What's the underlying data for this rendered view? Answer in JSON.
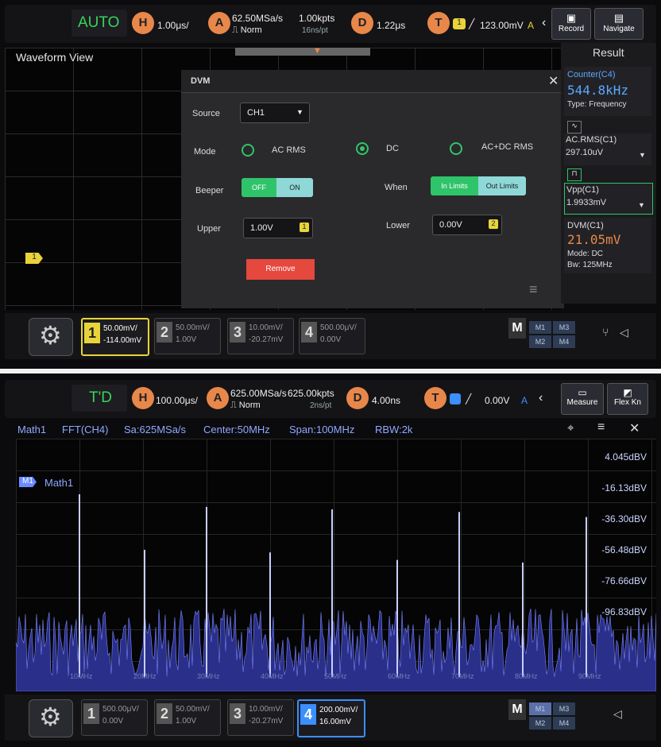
{
  "screen1": {
    "mode": "AUTO",
    "timebase": "1.00μs/",
    "sample_rate": "62.50MSa/s",
    "points": "1.00kpts",
    "acq_mode": "Norm",
    "acq_sub": "16ns/pt",
    "delay": "1.22μs",
    "trigger_level": "123.00mV",
    "trigger_mode": "A",
    "labels": {
      "h": "H",
      "a": "A",
      "d": "D",
      "t": "T"
    },
    "record_label": "Record",
    "navigate_label": "Navigate",
    "waveform_title": "Waveform View",
    "result_title": "Result",
    "dvm": {
      "title": "DVM",
      "source_label": "Source",
      "source_value": "CH1",
      "mode_label": "Mode",
      "mode_options": [
        "AC RMS",
        "DC",
        "AC+DC RMS"
      ],
      "beeper_label": "Beeper",
      "beeper_off": "OFF",
      "beeper_on": "ON",
      "when_label": "When",
      "when_in": "In Limits",
      "when_out": "Out Limits",
      "upper_label": "Upper",
      "upper_value": "1.00V",
      "upper_badge": "1",
      "lower_label": "Lower",
      "lower_value": "0.00V",
      "lower_badge": "2",
      "remove_label": "Remove"
    },
    "results": {
      "counter_title": "Counter(C4)",
      "counter_value": "544.8kHz",
      "counter_type": "Type:  Frequency",
      "acrms_title": "AC.RMS(C1)",
      "acrms_value": "297.10uV",
      "vpp_title": "Vpp(C1)",
      "vpp_value": "1.9933mV",
      "dvm_title": "DVM(C1)",
      "dvm_value": "21.05mV",
      "dvm_mode": "Mode: DC",
      "dvm_bw": "Bw:    125MHz"
    },
    "channel_marker": "1",
    "channels": [
      {
        "num": "1",
        "scale": "50.00mV/",
        "offset": "-114.00mV"
      },
      {
        "num": "2",
        "scale": "50.00mV/",
        "offset": "1.00V"
      },
      {
        "num": "3",
        "scale": "10.00mV/",
        "offset": "-20.27mV"
      },
      {
        "num": "4",
        "scale": "500.00μV/",
        "offset": "0.00V"
      }
    ],
    "math_buttons": {
      "big": "M",
      "m1": "M1",
      "m2": "M2",
      "m3": "M3",
      "m4": "M4"
    }
  },
  "screen2": {
    "mode": "T'D",
    "timebase": "100.00μs/",
    "sample_rate": "625.00MSa/s",
    "points": "625.00kpts",
    "acq_mode": "Norm",
    "acq_sub": "2ns/pt",
    "delay": "4.00ns",
    "trigger_level": "0.00V",
    "trigger_mode": "A",
    "measure_label": "Measure",
    "flex_label": "Flex Kn",
    "fft_header": {
      "math": "Math1",
      "source": "FFT(CH4)",
      "sa": "Sa:625MSa/s",
      "center": "Center:50MHz",
      "span": "Span:100MHz",
      "rbw": "RBW:2k"
    },
    "math_tag": "M1",
    "math_label": "Math1",
    "db_labels": [
      "4.045dBV",
      "-16.13dBV",
      "-36.30dBV",
      "-56.48dBV",
      "-76.66dBV",
      "-96.83dBV"
    ],
    "freq_labels": [
      "10MHz",
      "20MHz",
      "30MHz",
      "40MHz",
      "50MHz",
      "60MHz",
      "70MHz",
      "80MHz",
      "90MHz"
    ],
    "channels": [
      {
        "num": "1",
        "scale": "500.00μV/",
        "offset": "0.00V"
      },
      {
        "num": "2",
        "scale": "50.00mV/",
        "offset": "1.00V"
      },
      {
        "num": "3",
        "scale": "10.00mV/",
        "offset": "-20.27mV"
      },
      {
        "num": "4",
        "scale": "200.00mV/",
        "offset": "16.00mV"
      }
    ],
    "math_buttons": {
      "big": "M",
      "m1": "M1",
      "m2": "M2",
      "m3": "M3",
      "m4": "M4"
    }
  }
}
